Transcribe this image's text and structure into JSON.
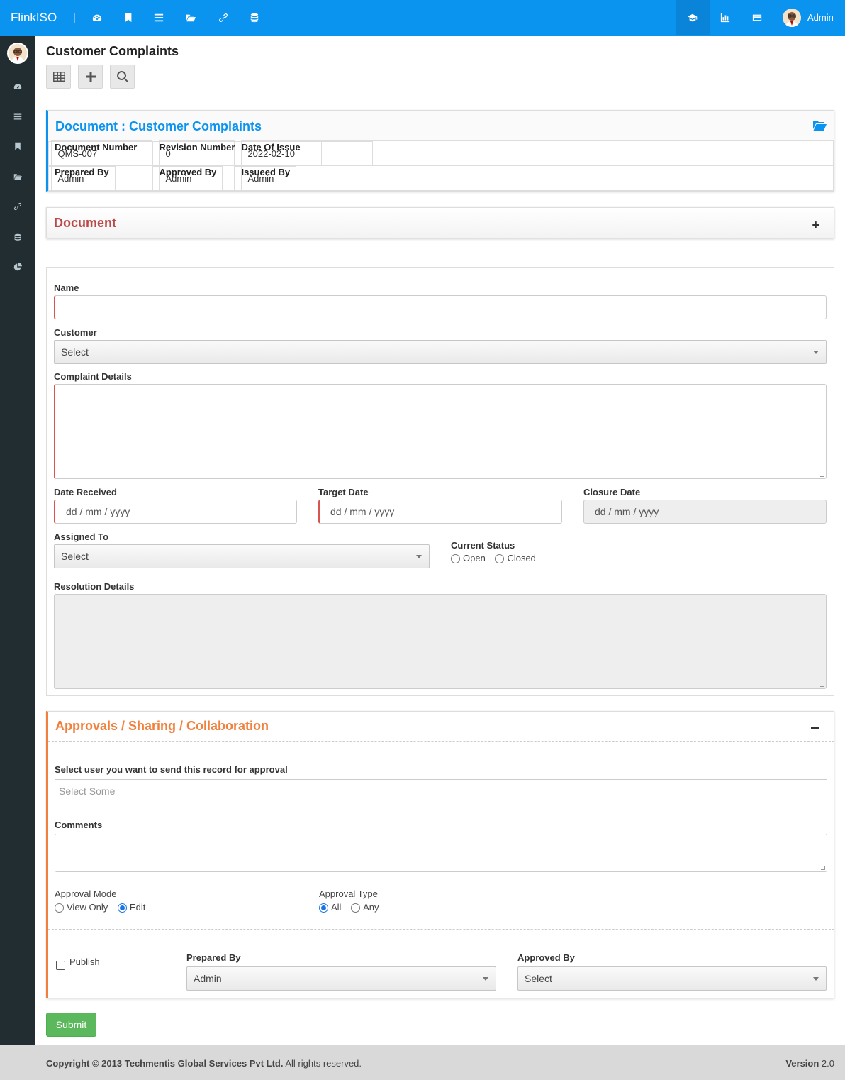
{
  "topbar": {
    "brand": "FlinkISO",
    "separator": "|",
    "nav_icons": [
      "dashboard-icon",
      "bookmark-icon",
      "list-icon",
      "folder-open-icon",
      "link-icon",
      "database-icon"
    ],
    "right_icons": [
      "graduation-cap-icon",
      "bar-chart-icon",
      "credit-card-icon"
    ],
    "user_name": "Admin"
  },
  "sidebar": {
    "icons": [
      "dashboard-icon",
      "server-icon",
      "bookmark-icon",
      "folder-open-icon",
      "link-icon",
      "database-icon",
      "pie-chart-icon"
    ]
  },
  "page": {
    "title": "Customer Complaints",
    "toolbar_icons": [
      "table-icon",
      "plus-icon",
      "search-icon"
    ]
  },
  "document_panel": {
    "title": "Document : Customer Complaints",
    "rows": [
      [
        {
          "label": "Document Number",
          "value": "QMS-007"
        },
        {
          "label": "Revision Number",
          "value": "0"
        },
        {
          "label": "Date Of Issue",
          "value": "2022-02-10"
        }
      ],
      [
        {
          "label": "Prepared By",
          "value": "Admin"
        },
        {
          "label": "Approved By",
          "value": "Admin"
        },
        {
          "label": "Issueed By",
          "value": "Admin"
        }
      ]
    ]
  },
  "document_collapse": {
    "title": "Document",
    "toggle": "+"
  },
  "form": {
    "name_label": "Name",
    "name_value": "",
    "customer_label": "Customer",
    "customer_value": "Select",
    "complaint_details_label": "Complaint Details",
    "date_received_label": "Date Received",
    "date_received_placeholder": "dd / mm / yyyy",
    "target_date_label": "Target Date",
    "target_date_placeholder": "dd / mm / yyyy",
    "closure_date_label": "Closure Date",
    "closure_date_placeholder": "dd / mm / yyyy",
    "assigned_to_label": "Assigned To",
    "assigned_to_value": "Select",
    "current_status_label": "Current Status",
    "status_options": [
      "Open",
      "Closed"
    ],
    "resolution_details_label": "Resolution Details"
  },
  "approvals": {
    "title": "Approvals / Sharing / Collaboration",
    "select_user_label": "Select user you want to send this record for approval",
    "select_user_placeholder": "Select Some",
    "comments_label": "Comments",
    "approval_mode_label": "Approval Mode",
    "approval_mode_options": [
      "View Only",
      "Edit"
    ],
    "approval_mode_selected": "Edit",
    "approval_type_label": "Approval Type",
    "approval_type_options": [
      "All",
      "Any"
    ],
    "approval_type_selected": "All",
    "publish_label": "Publish",
    "prepared_by_label": "Prepared By",
    "prepared_by_value": "Admin",
    "approved_by_label": "Approved By",
    "approved_by_value": "Select"
  },
  "submit_label": "Submit",
  "footer": {
    "copyright_prefix": "Copyright © 2013",
    "company": "Techmentis Global Services Pvt Ltd.",
    "rights": "All rights reserved.",
    "version_label": "Version",
    "version_value": "2.0"
  },
  "colors": {
    "topbar": "#0b93f0",
    "sidebar": "#222d32",
    "document_title": "#0b93f0",
    "collapse_title": "#b94a48",
    "approvals_accent": "#f0803c",
    "submit": "#5cb85c"
  }
}
